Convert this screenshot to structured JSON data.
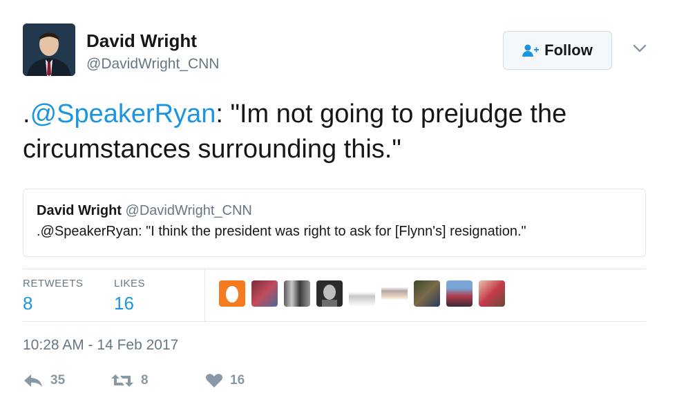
{
  "author": {
    "name": "David Wright",
    "handle": "@DavidWright_CNN"
  },
  "follow": {
    "label": "Follow"
  },
  "tweet": {
    "prefix": ".",
    "mention": "@SpeakerRyan",
    "body": ": \"Im not going to prejudge the circumstances surrounding this.\""
  },
  "quoted": {
    "name": "David Wright",
    "handle": "@DavidWright_CNN",
    "text": ".@SpeakerRyan: \"I think the president was right to ask for [Flynn's] resignation.\""
  },
  "stats": {
    "retweets_label": "RETWEETS",
    "retweets": "8",
    "likes_label": "LIKES",
    "likes": "16"
  },
  "timestamp": "10:28 AM - 14 Feb 2017",
  "actions": {
    "replies": "35",
    "retweets": "8",
    "likes": "16"
  },
  "colors": {
    "link": "#1b95e0",
    "secondary": "#657786",
    "icon": "#8899a6"
  },
  "icons": [
    "follow-person-icon",
    "chevron-down-icon",
    "reply-icon",
    "retweet-icon",
    "heart-icon"
  ]
}
